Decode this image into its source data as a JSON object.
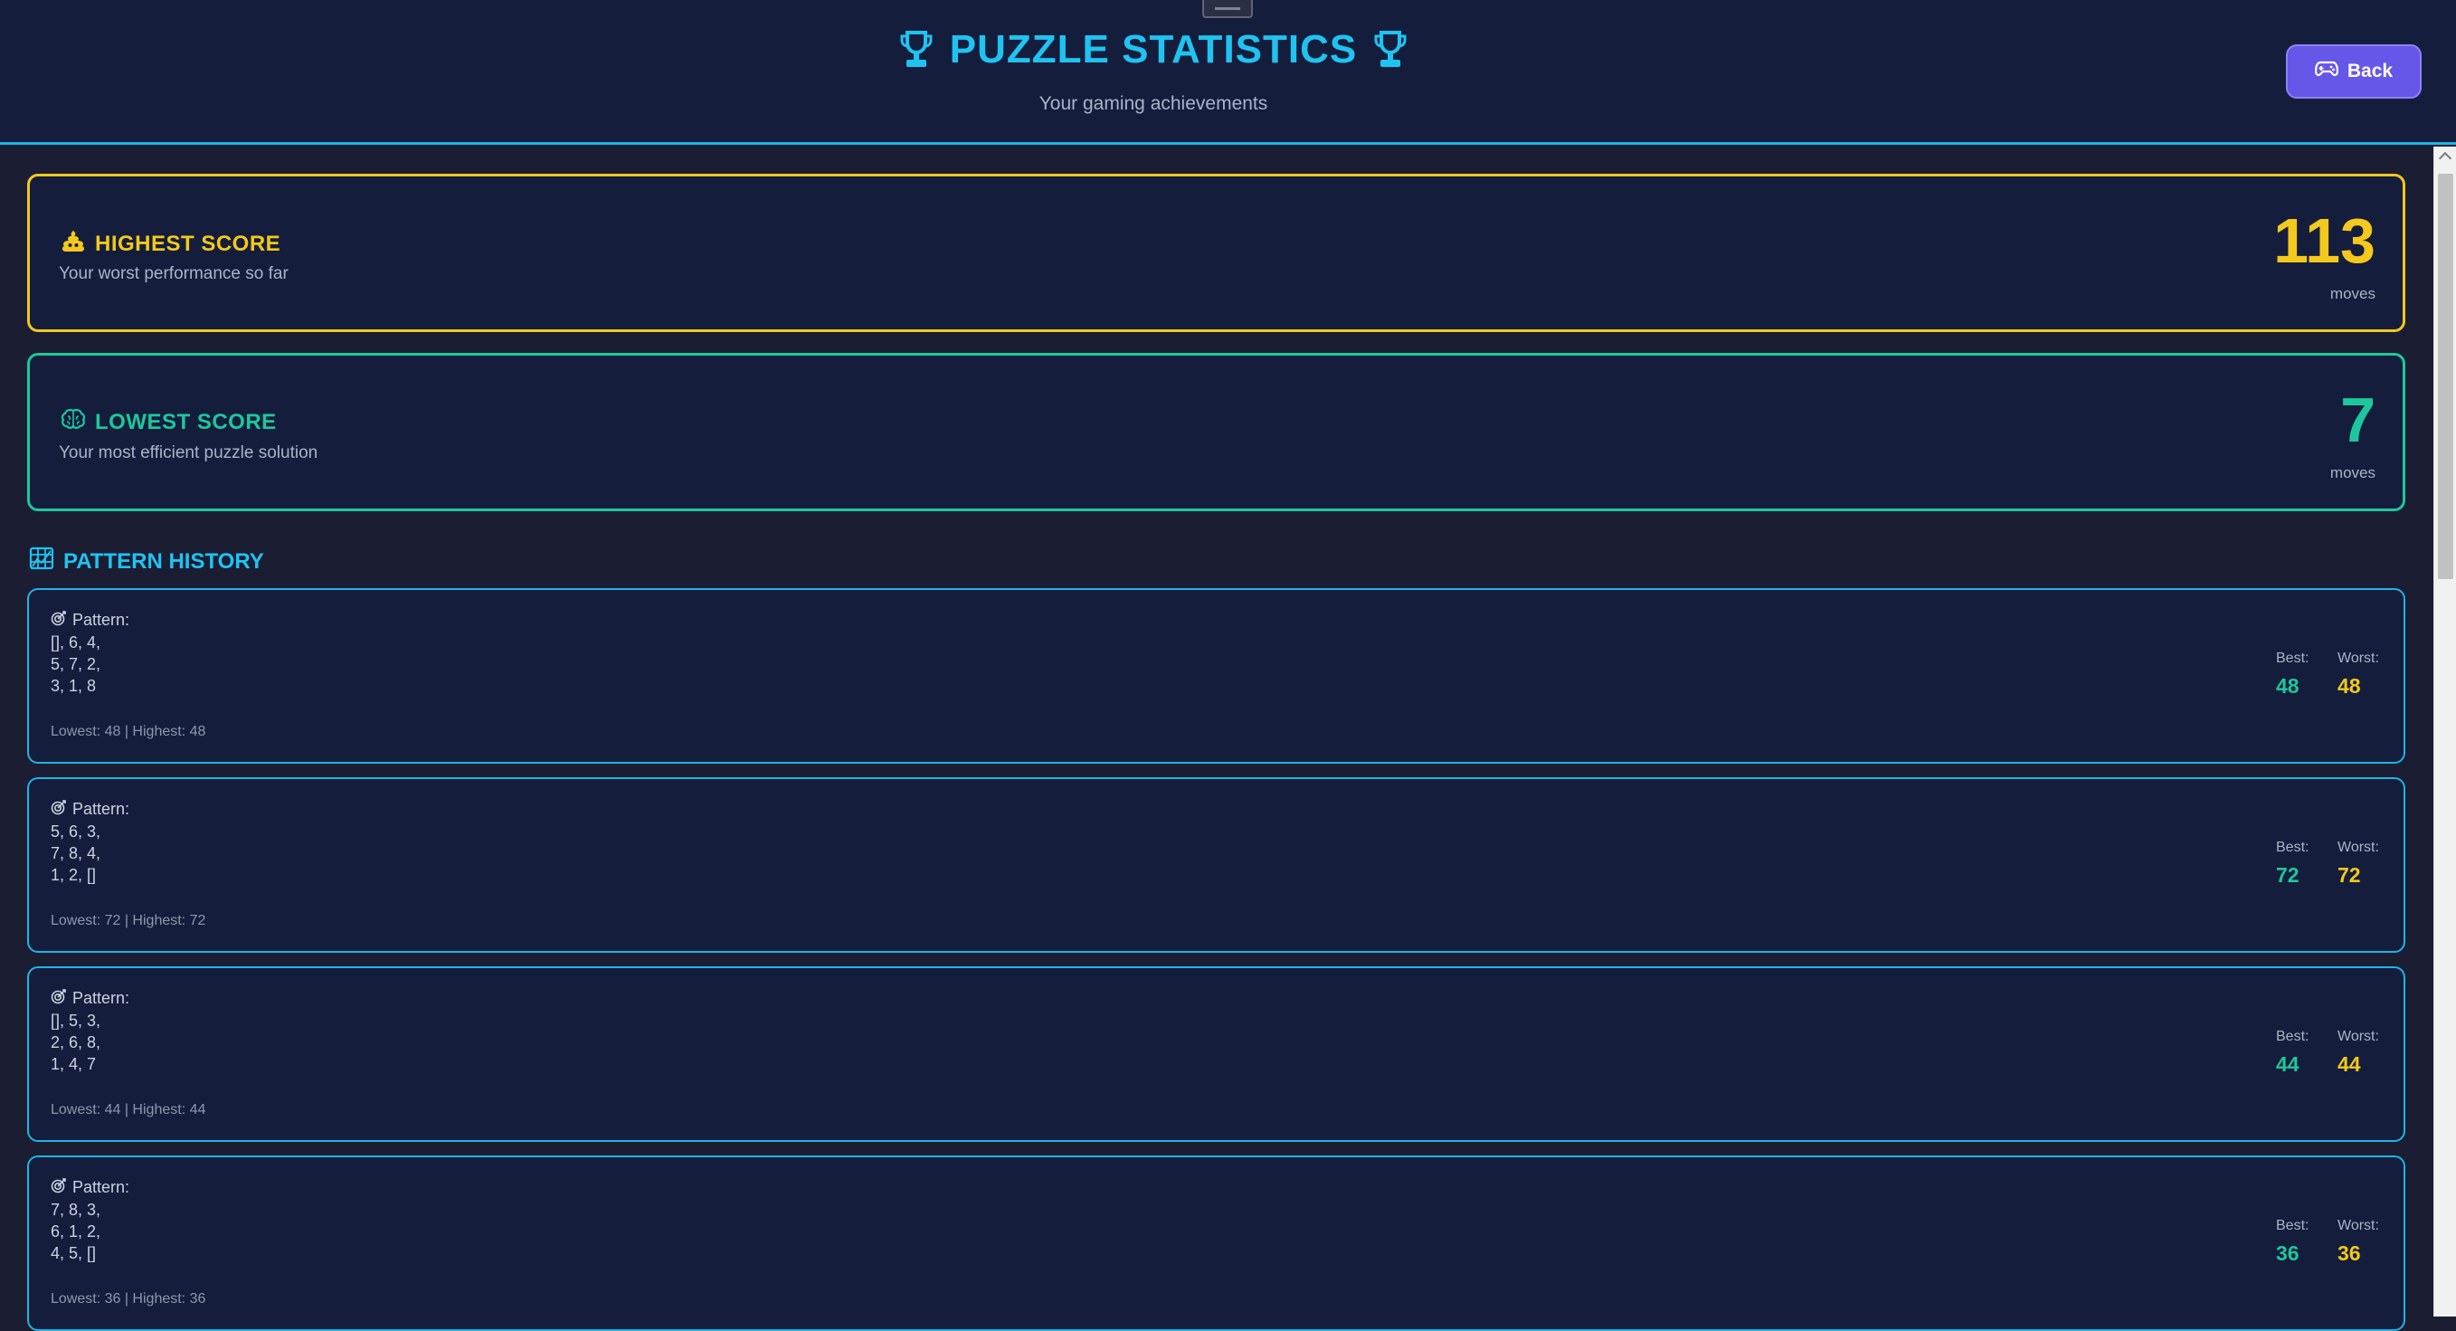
{
  "header": {
    "title": "PUZZLE STATISTICS",
    "subtitle": "Your gaming achievements",
    "back_label": "Back",
    "icons": {
      "title_left": "trophy-icon",
      "title_right": "trophy-icon",
      "back": "gamepad-icon"
    }
  },
  "colors": {
    "accent": "#1fc3f1",
    "highest": "#f4c81c",
    "lowest": "#1ec79b",
    "button": "#6757e8",
    "card_bg": "#141e3c"
  },
  "highest": {
    "label": "HIGHEST SCORE",
    "description": "Your worst performance so far",
    "value": "113",
    "unit": "moves",
    "icon": "poop-icon"
  },
  "lowest": {
    "label": "LOWEST SCORE",
    "description": "Your most efficient puzzle solution",
    "value": "7",
    "unit": "moves",
    "icon": "brain-icon"
  },
  "history": {
    "title": "PATTERN HISTORY",
    "icon": "grid-icon",
    "patterns": [
      {
        "label": "Pattern:",
        "lines": [
          "[], 6, 4,",
          "5, 7, 2,",
          "3, 1, 8"
        ],
        "footer": "Lowest: 48 | Highest: 48",
        "best_label": "Best:",
        "best": "48",
        "worst_label": "Worst:",
        "worst": "48"
      },
      {
        "label": "Pattern:",
        "lines": [
          "5, 6, 3,",
          "7, 8, 4,",
          "1, 2, []"
        ],
        "footer": "Lowest: 72 | Highest: 72",
        "best_label": "Best:",
        "best": "72",
        "worst_label": "Worst:",
        "worst": "72"
      },
      {
        "label": "Pattern:",
        "lines": [
          "[], 5, 3,",
          "2, 6, 8,",
          "1, 4, 7"
        ],
        "footer": "Lowest: 44 | Highest: 44",
        "best_label": "Best:",
        "best": "44",
        "worst_label": "Worst:",
        "worst": "44"
      },
      {
        "label": "Pattern:",
        "lines": [
          "7, 8, 3,",
          "6, 1, 2,",
          "4, 5, []"
        ],
        "footer": "Lowest: 36 | Highest: 36",
        "best_label": "Best:",
        "best": "36",
        "worst_label": "Worst:",
        "worst": "36"
      }
    ]
  }
}
